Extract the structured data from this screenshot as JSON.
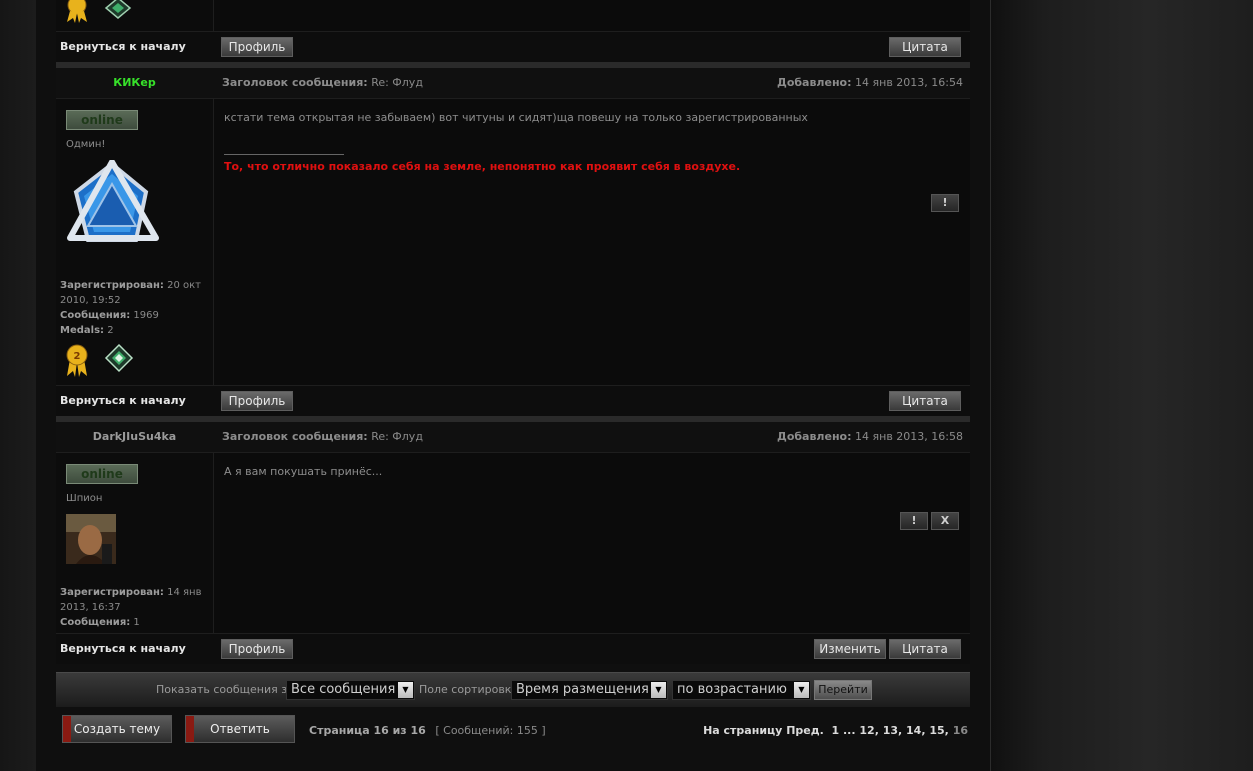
{
  "back_to_top": "Вернуться к началу",
  "buttons": {
    "profile": "Профиль",
    "quote": "Цитата",
    "edit": "Изменить",
    "report": "!",
    "delete": "X"
  },
  "labels": {
    "subject": "Заголовок сообщения:",
    "added": "Добавлено:",
    "registered": "Зарегистрирован:",
    "posts": "Сообщения:",
    "medals": "Medals:",
    "online": "online"
  },
  "posts": [
    {
      "author": "КИКер",
      "author_color": "#37e02a",
      "subject": "Re: Флуд",
      "date": "14 янв 2013, 16:54",
      "rank": "Одмин!",
      "registered": "20 окт 2010, 19:52",
      "post_count": "1969",
      "medal_count": "2",
      "body": "кстати тема открытая не забываем) вот читуны и сидят)ща повешу на только зарегистрированных",
      "signature": "То, что отлично показало себя на земле, непонятно как проявит себя в воздухе."
    },
    {
      "author": "DarkJIuSu4ka",
      "author_color": "#9a9a9a",
      "subject": "Re: Флуд",
      "date": "14 янв 2013, 16:58",
      "rank": "Шпион",
      "registered": "14 янв 2013, 16:37",
      "post_count": "1",
      "body": "А я вам покушать принёс..."
    }
  ],
  "medal_badge_number": "2",
  "sort_bar": {
    "show_label": "Показать сообщения за:",
    "show_value": "Все сообщения",
    "sort_label": "Поле сортировки",
    "sort_value": "Время размещения",
    "order_value": "по возрастанию",
    "go_label": "Перейти"
  },
  "actions": {
    "new_topic": "Создать тему",
    "reply": "Ответить"
  },
  "pagination": {
    "page_text": "Страница 16 из 16",
    "posts_total": "[ Сообщений: 155 ]",
    "goto_label": "На страницу",
    "prev_label": "Пред.",
    "pages": [
      "1",
      "...",
      "12",
      "13",
      "14",
      "15",
      "16"
    ]
  }
}
